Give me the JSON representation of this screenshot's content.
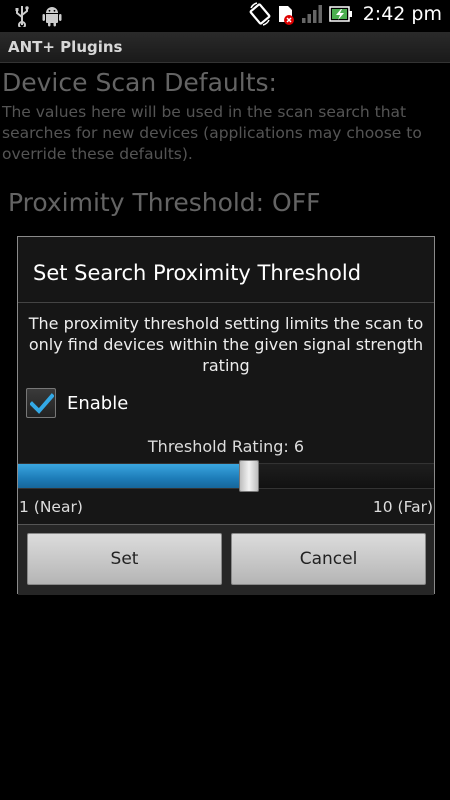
{
  "status_bar": {
    "time": "2:42 pm",
    "icons": [
      "usb-icon",
      "android-debug-icon",
      "screen-rotate-icon",
      "no-sim-icon",
      "signal-icon",
      "battery-charging-icon"
    ]
  },
  "app": {
    "title": "ANT+ Plugins"
  },
  "background": {
    "heading": "Device Scan Defaults:",
    "description": "The values here will be used in the scan search that searches for new devices (applications may choose to override these defaults).",
    "proximity_label": "Proximity Threshold:  OFF"
  },
  "dialog": {
    "title": "Set Search Proximity Threshold",
    "message": "The proximity threshold setting limits the scan to only find devices within the given signal strength rating",
    "enable_label": "Enable",
    "enable_checked": true,
    "threshold_label": "Threshold Rating: 6",
    "slider": {
      "min": 1,
      "max": 10,
      "value": 6,
      "fill_fraction": 0.555
    },
    "range_min_label": "1 (Near)",
    "range_max_label": "10 (Far)",
    "set_label": "Set",
    "cancel_label": "Cancel"
  },
  "colors": {
    "accent": "#2a8fcf",
    "background": "#000000",
    "dialog_bg": "#161616"
  }
}
